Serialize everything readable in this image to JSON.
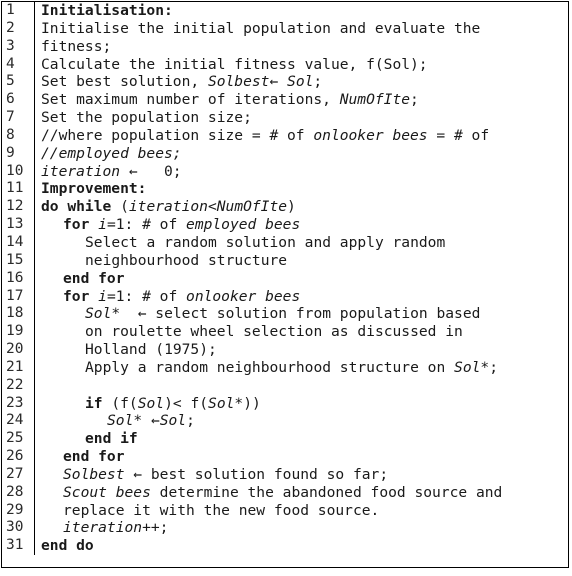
{
  "algorithm": {
    "title": "Artificial Bee Colony pseudocode",
    "language": "pseudocode",
    "style": {
      "border_color": "#000000",
      "gutter_separator_color": "#000000",
      "background_color": "#ffffff",
      "text_color": "#1a1a1a",
      "line_number_color": "#2b2b2b"
    },
    "total_lines": 31,
    "lines": [
      {
        "number": "1",
        "indent": 0,
        "text": "Initialisation:",
        "tokens": [
          {
            "t": "Initialisation:",
            "s": "b"
          }
        ]
      },
      {
        "number": "2",
        "indent": 0,
        "text": "Initialise the initial population and evaluate the",
        "tokens": [
          {
            "t": "Initialise the initial population and evaluate the",
            "s": "n"
          }
        ]
      },
      {
        "number": "3",
        "indent": 0,
        "text": "fitness;",
        "tokens": [
          {
            "t": "fitness;",
            "s": "n"
          }
        ]
      },
      {
        "number": "4",
        "indent": 0,
        "text": "Calculate the initial fitness value, f(Sol);",
        "tokens": [
          {
            "t": "Calculate the initial fitness value, f(Sol);",
            "s": "n"
          }
        ]
      },
      {
        "number": "5",
        "indent": 0,
        "text": "Set best solution, Solbest← Sol;",
        "tokens": [
          {
            "t": "Set best solution, ",
            "s": "n"
          },
          {
            "t": "Solbest",
            "s": "i"
          },
          {
            "t": "← ",
            "s": "n"
          },
          {
            "t": "Sol",
            "s": "i"
          },
          {
            "t": ";",
            "s": "n"
          }
        ]
      },
      {
        "number": "6",
        "indent": 0,
        "text": "Set maximum number of iterations, NumOfIte;",
        "tokens": [
          {
            "t": "Set maximum number of iterations, ",
            "s": "n"
          },
          {
            "t": "NumOfIte",
            "s": "i"
          },
          {
            "t": ";",
            "s": "n"
          }
        ]
      },
      {
        "number": "7",
        "indent": 0,
        "text": "Set the population size;",
        "tokens": [
          {
            "t": "Set the population size;",
            "s": "n"
          }
        ]
      },
      {
        "number": "8",
        "indent": 0,
        "text": "//where population size = # of onlooker bees = # of",
        "tokens": [
          {
            "t": "//where population size = # of ",
            "s": "n"
          },
          {
            "t": "onlooker bees",
            "s": "i"
          },
          {
            "t": " = # of",
            "s": "n"
          }
        ]
      },
      {
        "number": "9",
        "indent": 0,
        "text": "//employed bees;",
        "tokens": [
          {
            "t": "//employed bees;",
            "s": "i"
          }
        ]
      },
      {
        "number": "10",
        "indent": 0,
        "text": "iteration ←   0;",
        "tokens": [
          {
            "t": "iteration",
            "s": "i"
          },
          {
            "t": " ←   0;",
            "s": "n"
          }
        ]
      },
      {
        "number": "11",
        "indent": 0,
        "text": "Improvement:",
        "tokens": [
          {
            "t": "Improvement:",
            "s": "b"
          }
        ]
      },
      {
        "number": "12",
        "indent": 0,
        "text": "do while (iteration<NumOfIte)",
        "tokens": [
          {
            "t": "do while",
            "s": "b"
          },
          {
            "t": " (",
            "s": "n"
          },
          {
            "t": "iteration",
            "s": "i"
          },
          {
            "t": "<",
            "s": "n"
          },
          {
            "t": "NumOfIte",
            "s": "i"
          },
          {
            "t": ")",
            "s": "n"
          }
        ]
      },
      {
        "number": "13",
        "indent": 1,
        "text": "for i=1: # of employed bees",
        "tokens": [
          {
            "t": "for",
            "s": "b"
          },
          {
            "t": " ",
            "s": "n"
          },
          {
            "t": "i",
            "s": "i"
          },
          {
            "t": "=1: # of ",
            "s": "n"
          },
          {
            "t": "employed bees",
            "s": "i"
          }
        ]
      },
      {
        "number": "14",
        "indent": 2,
        "text": "Select a random solution and apply random",
        "tokens": [
          {
            "t": "Select a random solution and apply random",
            "s": "n"
          }
        ]
      },
      {
        "number": "15",
        "indent": 2,
        "text": "neighbourhood structure",
        "tokens": [
          {
            "t": "neighbourhood structure",
            "s": "n"
          }
        ]
      },
      {
        "number": "16",
        "indent": 1,
        "text": "end for",
        "tokens": [
          {
            "t": "end for",
            "s": "b"
          }
        ]
      },
      {
        "number": "17",
        "indent": 1,
        "text": "for i=1: # of onlooker bees",
        "tokens": [
          {
            "t": "for",
            "s": "b"
          },
          {
            "t": " ",
            "s": "n"
          },
          {
            "t": "i",
            "s": "i"
          },
          {
            "t": "=1: # of ",
            "s": "n"
          },
          {
            "t": "onlooker bees",
            "s": "i"
          }
        ]
      },
      {
        "number": "18",
        "indent": 2,
        "text": "Sol*  ← select solution from population based",
        "tokens": [
          {
            "t": "Sol*",
            "s": "i"
          },
          {
            "t": "  ← select solution from population based",
            "s": "n"
          }
        ]
      },
      {
        "number": "19",
        "indent": 2,
        "text": "on roulette wheel selection as discussed in",
        "tokens": [
          {
            "t": "on roulette wheel selection as discussed in",
            "s": "n"
          }
        ]
      },
      {
        "number": "20",
        "indent": 2,
        "text": "Holland (1975);",
        "tokens": [
          {
            "t": "Holland (1975);",
            "s": "n"
          }
        ]
      },
      {
        "number": "21",
        "indent": 2,
        "text": "Apply a random neighbourhood structure on Sol*;",
        "tokens": [
          {
            "t": "Apply a random neighbourhood structure on ",
            "s": "n"
          },
          {
            "t": "Sol*",
            "s": "i"
          },
          {
            "t": ";",
            "s": "n"
          }
        ]
      },
      {
        "number": "22",
        "indent": 0,
        "text": "",
        "tokens": [
          {
            "t": "",
            "s": "n"
          }
        ]
      },
      {
        "number": "23",
        "indent": 2,
        "text": "if (f(Sol)< f(Sol*))",
        "tokens": [
          {
            "t": "if",
            "s": "b"
          },
          {
            "t": " (f(",
            "s": "n"
          },
          {
            "t": "Sol",
            "s": "i"
          },
          {
            "t": ")< f(",
            "s": "n"
          },
          {
            "t": "Sol*",
            "s": "i"
          },
          {
            "t": "))",
            "s": "n"
          }
        ]
      },
      {
        "number": "24",
        "indent": 3,
        "text": "Sol* ←Sol;",
        "tokens": [
          {
            "t": "Sol*",
            "s": "i"
          },
          {
            "t": " ←",
            "s": "n"
          },
          {
            "t": "Sol",
            "s": "i"
          },
          {
            "t": ";",
            "s": "n"
          }
        ]
      },
      {
        "number": "25",
        "indent": 2,
        "text": "end if",
        "tokens": [
          {
            "t": "end if",
            "s": "b"
          }
        ]
      },
      {
        "number": "26",
        "indent": 1,
        "text": "end for",
        "tokens": [
          {
            "t": "end for",
            "s": "b"
          }
        ]
      },
      {
        "number": "27",
        "indent": 1,
        "text": "Solbest ← best solution found so far;",
        "tokens": [
          {
            "t": "Solbest",
            "s": "i"
          },
          {
            "t": " ← best solution found so far;",
            "s": "n"
          }
        ]
      },
      {
        "number": "28",
        "indent": 1,
        "text": "Scout bees determine the abandoned food source and",
        "tokens": [
          {
            "t": "Scout bees",
            "s": "i"
          },
          {
            "t": " determine the abandoned food source and",
            "s": "n"
          }
        ]
      },
      {
        "number": "29",
        "indent": 1,
        "text": "replace it with the new food source.",
        "tokens": [
          {
            "t": "replace it with the new food source.",
            "s": "n"
          }
        ]
      },
      {
        "number": "30",
        "indent": 1,
        "text": "iteration++;",
        "tokens": [
          {
            "t": "iteration",
            "s": "i"
          },
          {
            "t": "++;",
            "s": "n"
          }
        ]
      },
      {
        "number": "31",
        "indent": 0,
        "text": "end do",
        "tokens": [
          {
            "t": "end do",
            "s": "b"
          }
        ]
      }
    ]
  }
}
